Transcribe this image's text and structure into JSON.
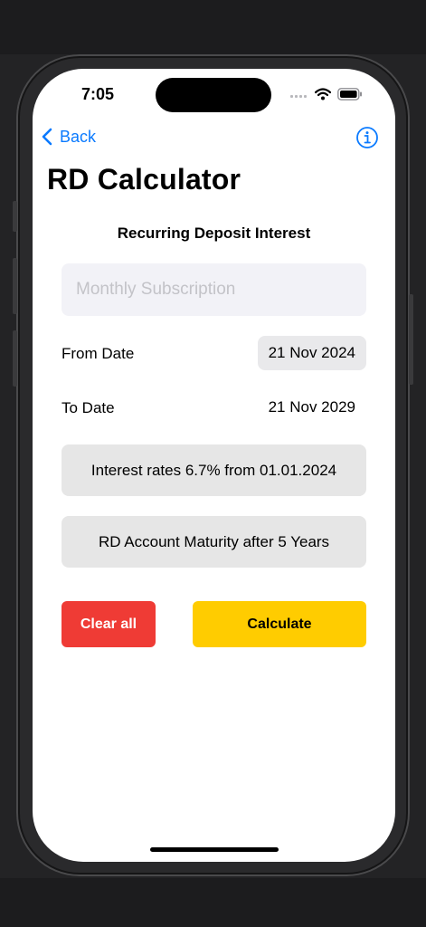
{
  "status": {
    "time": "7:05"
  },
  "nav": {
    "back_label": "Back"
  },
  "page": {
    "title": "RD Calculator",
    "subtitle": "Recurring Deposit Interest"
  },
  "form": {
    "monthly_placeholder": "Monthly Subscription",
    "monthly_value": "",
    "from_label": "From Date",
    "from_value": "21 Nov 2024",
    "to_label": "To Date",
    "to_value": "21 Nov 2029",
    "interest_info": "Interest rates 6.7% from 01.01.2024",
    "maturity_info": "RD Account Maturity after 5 Years"
  },
  "actions": {
    "clear_label": "Clear all",
    "calculate_label": "Calculate"
  },
  "icons": {
    "back": "chevron-left-icon",
    "info": "info-circle-icon",
    "signal": "signal-icon",
    "wifi": "wifi-icon",
    "battery": "battery-icon"
  },
  "colors": {
    "accent": "#0a7aff",
    "clear": "#ef3b35",
    "calculate": "#ffcc00"
  }
}
